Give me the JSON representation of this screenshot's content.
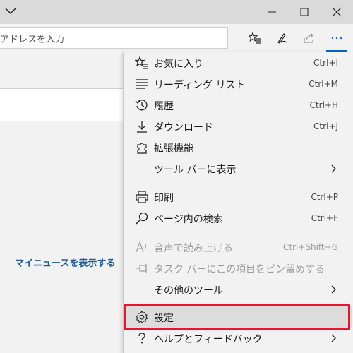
{
  "address_bar": {
    "url_placeholder": "アドレスを入力"
  },
  "page": {
    "news_link": "マイニュースを表示する"
  },
  "menu": {
    "items": [
      {
        "label": "お気に入り",
        "shortcut": "Ctrl+I",
        "icon": "favorites-icon"
      },
      {
        "label": "リーディング リスト",
        "shortcut": "Ctrl+M",
        "icon": "reading-list-icon"
      },
      {
        "label": "履歴",
        "shortcut": "Ctrl+H",
        "icon": "history-icon"
      },
      {
        "label": "ダウンロード",
        "shortcut": "Ctrl+J",
        "icon": "download-icon"
      },
      {
        "label": "拡張機能",
        "shortcut": "",
        "icon": "extensions-icon"
      },
      {
        "label": "ツール バーに表示",
        "shortcut": "",
        "icon": "",
        "submenu": true
      },
      {
        "label": "印刷",
        "shortcut": "Ctrl+P",
        "icon": "print-icon"
      },
      {
        "label": "ページ内の検索",
        "shortcut": "Ctrl+F",
        "icon": "search-icon"
      },
      {
        "label": "音声で読み上げる",
        "shortcut": "Ctrl+Shift+G",
        "icon": "read-aloud-icon",
        "disabled": true
      },
      {
        "label": "タスク バーにこの項目をピン留めする",
        "shortcut": "",
        "icon": "pin-icon",
        "disabled": true
      },
      {
        "label": "その他のツール",
        "shortcut": "",
        "icon": "",
        "submenu": true
      },
      {
        "label": "設定",
        "shortcut": "",
        "icon": "settings-icon",
        "highlighted": true
      },
      {
        "label": "ヘルプとフィードバック",
        "shortcut": "",
        "icon": "help-icon",
        "submenu": true
      }
    ]
  },
  "colors": {
    "accent": "#0a64c9",
    "highlight_frame": "#e8162c",
    "link": "#1f5d99"
  }
}
